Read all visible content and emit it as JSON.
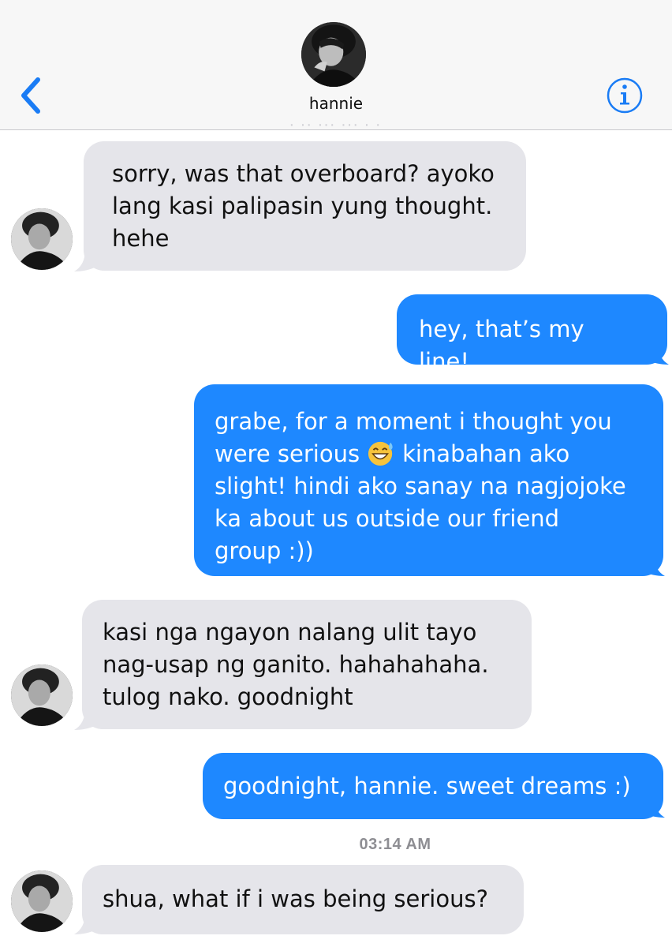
{
  "header": {
    "contact_name": "hannie",
    "faded_timestamp": "· ·· ··· ··· · ·"
  },
  "messages": [
    {
      "direction": "in",
      "text": "sorry, was that overboard? ayoko\nlang kasi palipasin yung thought.\nhehe"
    },
    {
      "direction": "out",
      "text": "hey, that’s my line!"
    },
    {
      "direction": "out",
      "line1": "grabe, for a moment i thought you",
      "line2a": "were serious",
      "emoji": "grinning-sweat-face",
      "line2b": "kinabahan ako",
      "rest": "slight! hindi ako sanay na nagjojoke\nka about us outside our friend\ngroup :))"
    },
    {
      "direction": "in",
      "text": "kasi nga ngayon nalang ulit tayo\nnag-usap ng ganito. hahahahaha.\ntulog nako. goodnight"
    },
    {
      "direction": "out",
      "text": "goodnight, hannie. sweet dreams :)"
    },
    {
      "direction": "in",
      "text": "shua, what if i was being serious?"
    }
  ],
  "timestamp": "03:14 AM",
  "colors": {
    "incoming_bubble": "#e5e5ea",
    "outgoing_bubble": "#1e88ff",
    "accent": "#1a7cf5",
    "header_bg": "#f7f7f7"
  },
  "icons": {
    "back": "chevron-left-icon",
    "info": "info-icon"
  }
}
